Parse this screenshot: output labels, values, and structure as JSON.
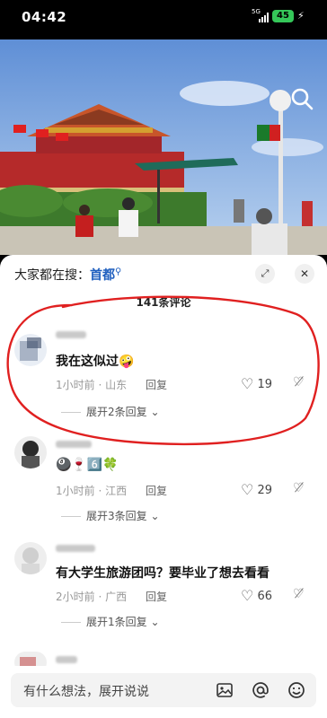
{
  "status_bar": {
    "time": "04:42",
    "network": "5G",
    "battery": "45"
  },
  "video": {
    "search_icon": "search-icon"
  },
  "sheet": {
    "search_prefix": "大家都在搜：",
    "search_keyword": "首都",
    "search_keyword_icon": "search-small-icon",
    "expand_icon": "expand-icon",
    "close_icon": "close-icon",
    "comment_count": "141条评论"
  },
  "comments": [
    {
      "text": "我在这似过🤪",
      "time_location": "1小时前 · 山东",
      "reply_label": "回复",
      "likes": "19",
      "more_replies": "展开2条回复"
    },
    {
      "text": "🎱🍷6️⃣🍀",
      "time_location": "1小时前 · 江西",
      "reply_label": "回复",
      "likes": "29",
      "more_replies": "展开3条回复"
    },
    {
      "text": "有大学生旅游团吗？要毕业了想去看看",
      "time_location": "2小时前 · 广西",
      "reply_label": "回复",
      "likes": "66",
      "more_replies": "展开1条回复"
    }
  ],
  "input_bar": {
    "placeholder": "有什么想法，展开说说",
    "image_icon": "image-icon",
    "at_icon": "at-icon",
    "emoji_icon": "emoji-icon"
  },
  "colors": {
    "keyword_blue": "#1f5fbf",
    "annotation_red": "#e02020",
    "battery_green": "#35c759"
  }
}
